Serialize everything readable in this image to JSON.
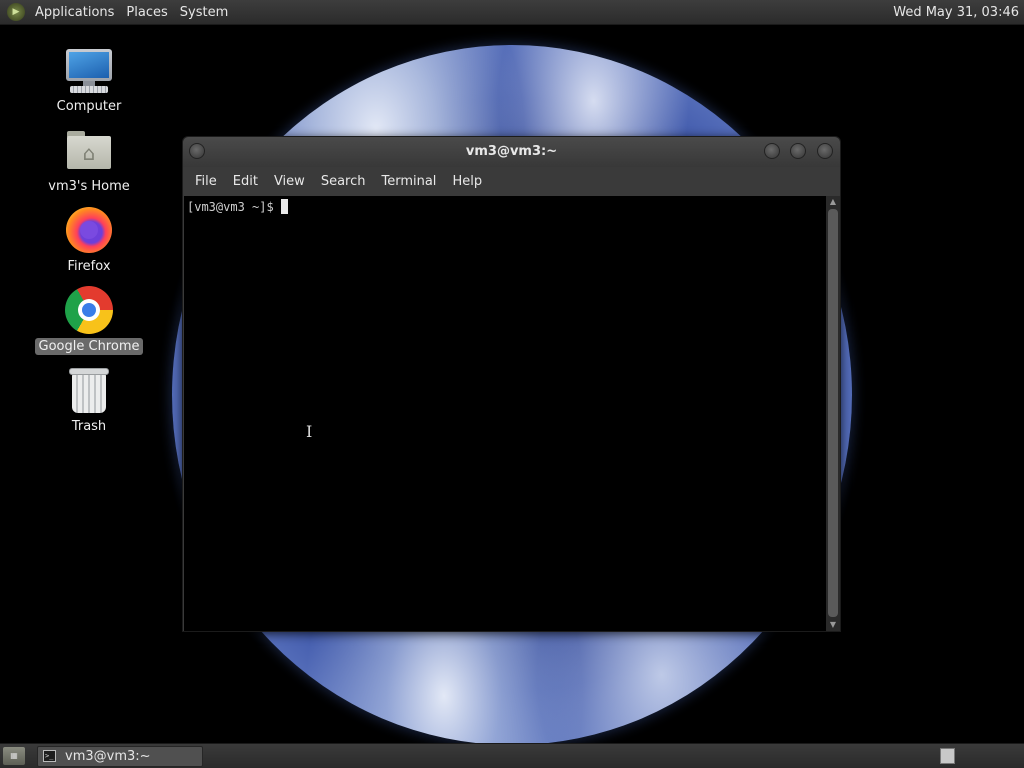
{
  "top_panel": {
    "menus": [
      "Applications",
      "Places",
      "System"
    ],
    "clock": "Wed May 31, 03:46"
  },
  "desktop": {
    "icons": [
      {
        "label": "Computer",
        "icon": "computer-icon"
      },
      {
        "label": "vm3's Home",
        "icon": "home-folder-icon"
      },
      {
        "label": "Firefox",
        "icon": "firefox-icon"
      },
      {
        "label": "Google Chrome",
        "icon": "chrome-icon",
        "selected": true
      },
      {
        "label": "Trash",
        "icon": "trash-icon"
      }
    ]
  },
  "terminal": {
    "title": "vm3@vm3:~",
    "menu": [
      "File",
      "Edit",
      "View",
      "Search",
      "Terminal",
      "Help"
    ],
    "prompt": "[vm3@vm3 ~]$"
  },
  "bottom_panel": {
    "tasks": [
      {
        "label": "vm3@vm3:~",
        "icon": "terminal-icon"
      }
    ]
  }
}
